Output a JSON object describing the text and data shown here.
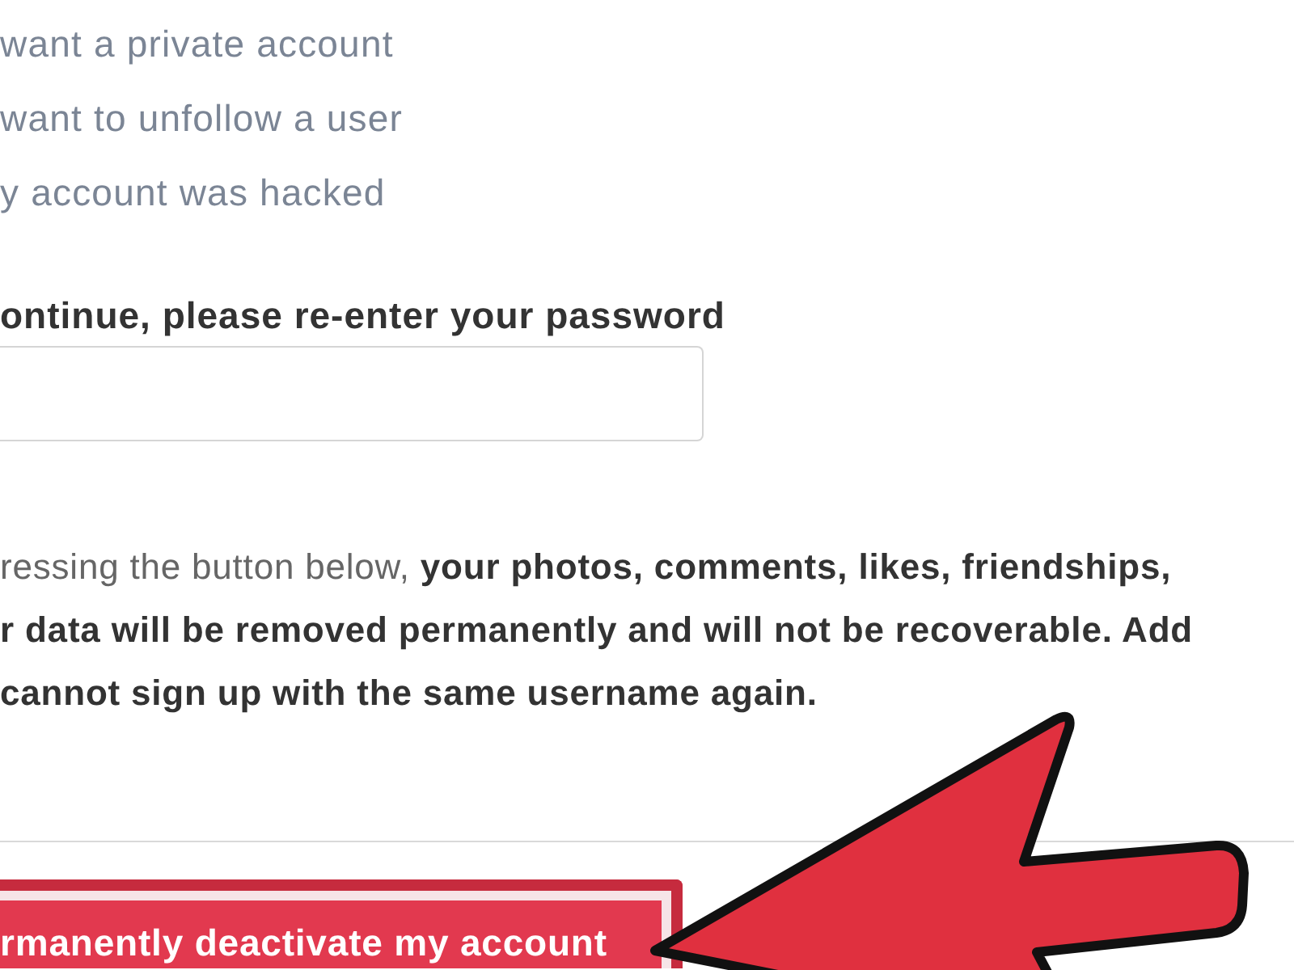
{
  "reason_options": [
    {
      "label": "want a private account"
    },
    {
      "label": "want to unfollow a user"
    },
    {
      "label": "y account was hacked"
    }
  ],
  "password_prompt": {
    "label": "ontinue, please re-enter your password"
  },
  "notice": {
    "lines": [
      "ressing the button below, **your photos, comments, likes, friendships,**",
      "**r data will be removed permanently and will not be recoverable. Add**",
      "**cannot sign up with the same username again.**"
    ]
  },
  "deactivate_button": {
    "label": "rmanently deactivate my account"
  },
  "annotations": [
    {
      "kind": "arrow"
    }
  ]
}
